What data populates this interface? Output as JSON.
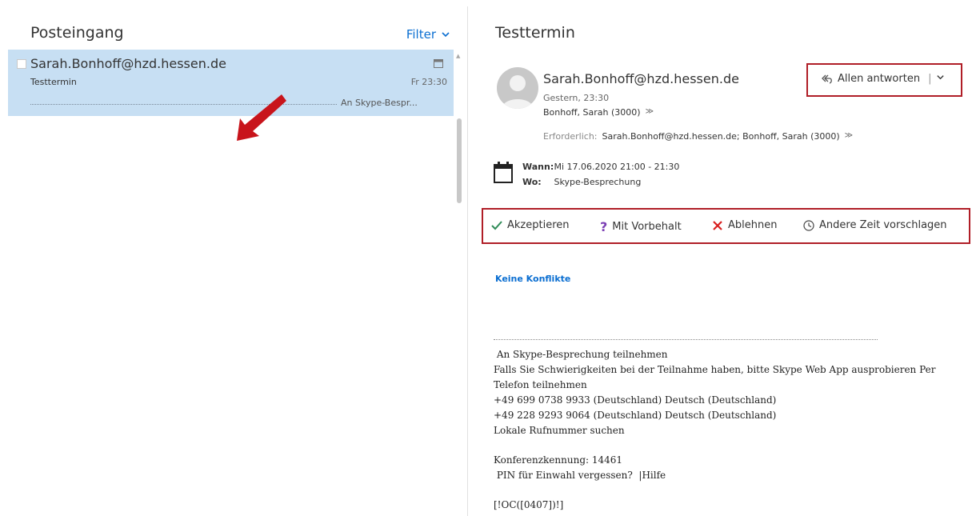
{
  "inbox": {
    "title": "Posteingang",
    "filter_label": "Filter"
  },
  "mail_item": {
    "from": "Sarah.Bonhoff@hzd.hessen.de",
    "subject": "Testtermin",
    "time": "Fr 23:30",
    "preview": "An Skype-Bespr..."
  },
  "reading": {
    "title": "Testtermin",
    "sender": "Sarah.Bonhoff@hzd.hessen.de",
    "sent": "Gestern, 23:30",
    "to": "Bonhoff, Sarah (3000)",
    "reply_all_label": "Allen antworten",
    "required_label": "Erforderlich:",
    "required_value": "Sarah.Bonhoff@hzd.hessen.de; Bonhoff, Sarah (3000)",
    "when_label": "Wann:",
    "when_value": "Mi 17.06.2020 21:00 - 21:30",
    "where_label": "Wo:",
    "where_value": "Skype-Besprechung"
  },
  "responses": {
    "accept": "Akzeptieren",
    "tentative": "Mit Vorbehalt",
    "decline": "Ablehnen",
    "propose": "Andere Zeit vorschlagen"
  },
  "no_conflicts": "Keine Konflikte",
  "body": {
    "line1": " An Skype-Besprechung teilnehmen",
    "line2": "Falls Sie Schwierigkeiten bei der Teilnahme haben, bitte Skype Web App ausprobieren Per Telefon teilnehmen",
    "line3": "+49 699 0738 9933 (Deutschland) Deutsch (Deutschland)",
    "line4": "+49 228 9293 9064 (Deutschland) Deutsch (Deutschland)",
    "line5": "Lokale Rufnummer suchen",
    "line6": "Konferenzkennung: 14461",
    "line7": " PIN für Einwahl vergessen?  |Hilfe",
    "line8": "[!OC([0407])!]"
  },
  "colors": {
    "accent": "#0a6ed1",
    "selected_bg": "#c7dff3",
    "highlight_border": "#b01e27",
    "accept": "#2e8b57",
    "tentative": "#7b3fb4",
    "decline": "#d81e1e"
  }
}
